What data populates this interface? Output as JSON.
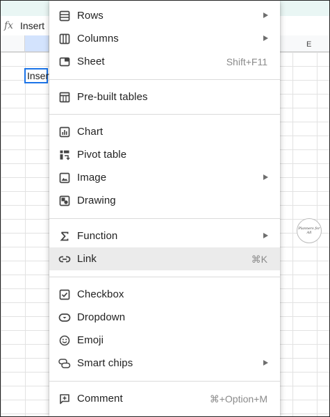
{
  "formula_bar": {
    "fx_label": "fx",
    "value": "Insert"
  },
  "grid": {
    "column_e": "E",
    "selected_cell_text": "Insert"
  },
  "watermark_text": "Planners for All",
  "menu": {
    "items": [
      {
        "label": "Rows",
        "icon": "rows-icon",
        "submenu": true
      },
      {
        "label": "Columns",
        "icon": "columns-icon",
        "submenu": true
      },
      {
        "label": "Sheet",
        "icon": "sheet-icon",
        "shortcut": "Shift+F11"
      },
      {
        "label": "Pre-built tables",
        "icon": "table-icon"
      },
      {
        "label": "Chart",
        "icon": "chart-icon"
      },
      {
        "label": "Pivot table",
        "icon": "pivot-table-icon"
      },
      {
        "label": "Image",
        "icon": "image-icon",
        "submenu": true
      },
      {
        "label": "Drawing",
        "icon": "drawing-icon"
      },
      {
        "label": "Function",
        "icon": "sigma-icon",
        "submenu": true
      },
      {
        "label": "Link",
        "icon": "link-icon",
        "shortcut": "⌘K",
        "highlighted": true
      },
      {
        "label": "Checkbox",
        "icon": "checkbox-icon"
      },
      {
        "label": "Dropdown",
        "icon": "dropdown-icon"
      },
      {
        "label": "Emoji",
        "icon": "emoji-icon"
      },
      {
        "label": "Smart chips",
        "icon": "smart-chips-icon",
        "submenu": true
      },
      {
        "label": "Comment",
        "icon": "comment-icon",
        "shortcut": "⌘+Option+M"
      }
    ]
  },
  "colors": {
    "highlight": "#ebebeb",
    "selection": "#1a73e8",
    "header_selected": "#d3e3fd",
    "top_band": "#e9f6f4"
  }
}
